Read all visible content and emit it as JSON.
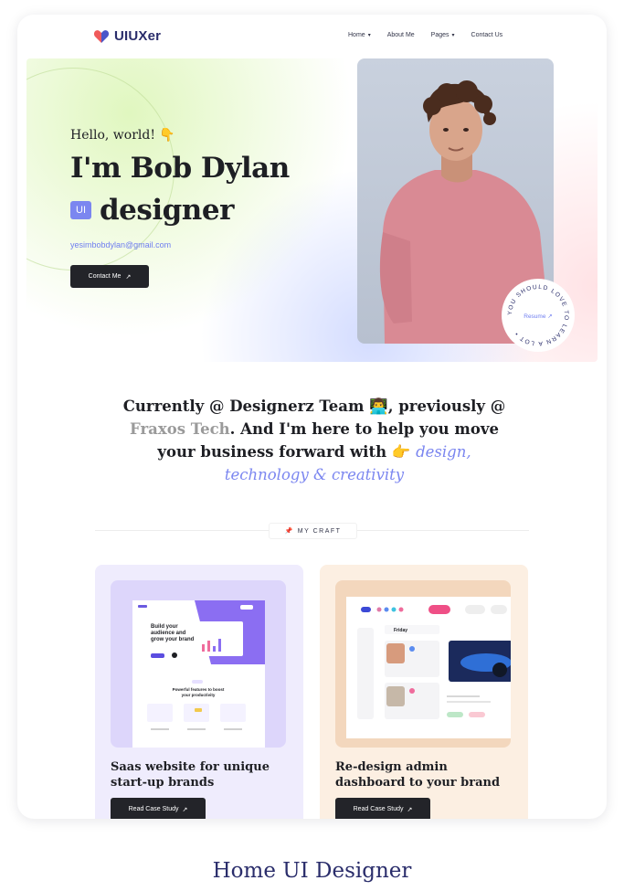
{
  "brand": {
    "name": "UIUXer",
    "colors": {
      "primary": "#2a2d6b",
      "accent": "#7b86f0",
      "heart_left": "#f05a5a",
      "heart_right": "#4a55c9"
    }
  },
  "nav": {
    "items": [
      {
        "label": "Home",
        "icon": "chevron-down-icon"
      },
      {
        "label": "About Me"
      },
      {
        "label": "Pages",
        "icon": "chevron-down-icon"
      },
      {
        "label": "Contact Us"
      }
    ]
  },
  "hero": {
    "greeting": "Hello, world!",
    "greeting_icon": "👇",
    "headline": "I'm Bob Dylan",
    "role_badge": "UI",
    "role": "designer",
    "email": "yesimbobdylan@gmail.com",
    "contact_button": "Contact Me",
    "arrow": "↗"
  },
  "resume_badge": {
    "label": "Resume",
    "arrow": "↗",
    "ring_text": "YOU SHOULD LOVE TO LEARN A LOT •"
  },
  "intro": {
    "part1": "Currently @ Designerz Team ",
    "emoji1": "👨‍💻",
    "part2": ", previously @ ",
    "muted": "Fraxos Tech",
    "part3": ". And I'm here to help you move your business forward with ",
    "emoji2": "👉",
    "accent1": "design,",
    "accent2": "technology & creativity"
  },
  "craft": {
    "pin": "📌",
    "label": "MY CRAFT"
  },
  "projects": [
    {
      "title": "Saas website for unique start-up brands",
      "button": "Read Case Study",
      "arrow": "↗",
      "mock": {
        "hero_line1": "Build your",
        "hero_line2": "audience and",
        "hero_line3": "grow your brand",
        "features": "Powerful features to boost",
        "features2": "your productivity"
      }
    },
    {
      "title": "Re-design admin dashboard to your brand",
      "button": "Read Case Study",
      "arrow": "↗",
      "mock": {
        "day": "Friday"
      }
    }
  ],
  "caption": "Home UI Designer"
}
